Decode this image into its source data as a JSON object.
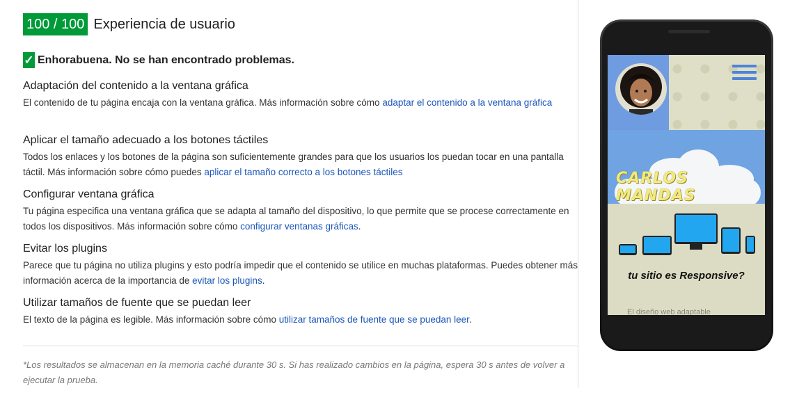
{
  "header": {
    "score": "100 / 100",
    "title": "Experiencia de usuario"
  },
  "summary": {
    "text": "Enhorabuena. No se han encontrado problemas."
  },
  "rules": [
    {
      "title": "Adaptación del contenido a la ventana gráfica",
      "text": "El contenido de tu página encaja con la ventana gráfica. Más información sobre cómo ",
      "link": "adaptar el contenido a la ventana gráfica",
      "after": ""
    },
    {
      "title": "Aplicar el tamaño adecuado a los botones táctiles",
      "text": "Todos los enlaces y los botones de la página son suficientemente grandes para que los usuarios los puedan tocar en una pantalla táctil. Más información sobre cómo puedes ",
      "link": "aplicar el tamaño correcto a los botones táctiles",
      "after": ""
    },
    {
      "title": "Configurar ventana gráfica",
      "text": "Tu página especifica una ventana gráfica que se adapta al tamaño del dispositivo, lo que permite que se procese correctamente en todos los dispositivos. Más información sobre cómo ",
      "link": "configurar ventanas gráficas",
      "after": "."
    },
    {
      "title": "Evitar los plugins",
      "text": "Parece que tu página no utiliza plugins y esto podría impedir que el contenido se utilice en muchas plataformas. Puedes obtener más información acerca de la importancia de ",
      "link": "evitar los plugins",
      "after": "."
    },
    {
      "title": "Utilizar tamaños de fuente que se puedan leer",
      "text": "El texto de la página es legible. Más información sobre cómo ",
      "link": "utilizar tamaños de fuente que se puedan leer",
      "after": "."
    }
  ],
  "footer": {
    "note": "*Los resultados se almacenan en la memoria caché durante 30 s. Si has realizado cambios en la página, espera 30 s antes de volver a ejecutar la prueba."
  },
  "phone_preview": {
    "logo_text": "CARLOS MANDAS",
    "tagline": "tu sitio es Responsive?",
    "cut_text": "El diseño web adaptable"
  },
  "colors": {
    "score_bg": "#009a38",
    "link": "#1a56b8",
    "accent_blue": "#6fa3e2"
  }
}
